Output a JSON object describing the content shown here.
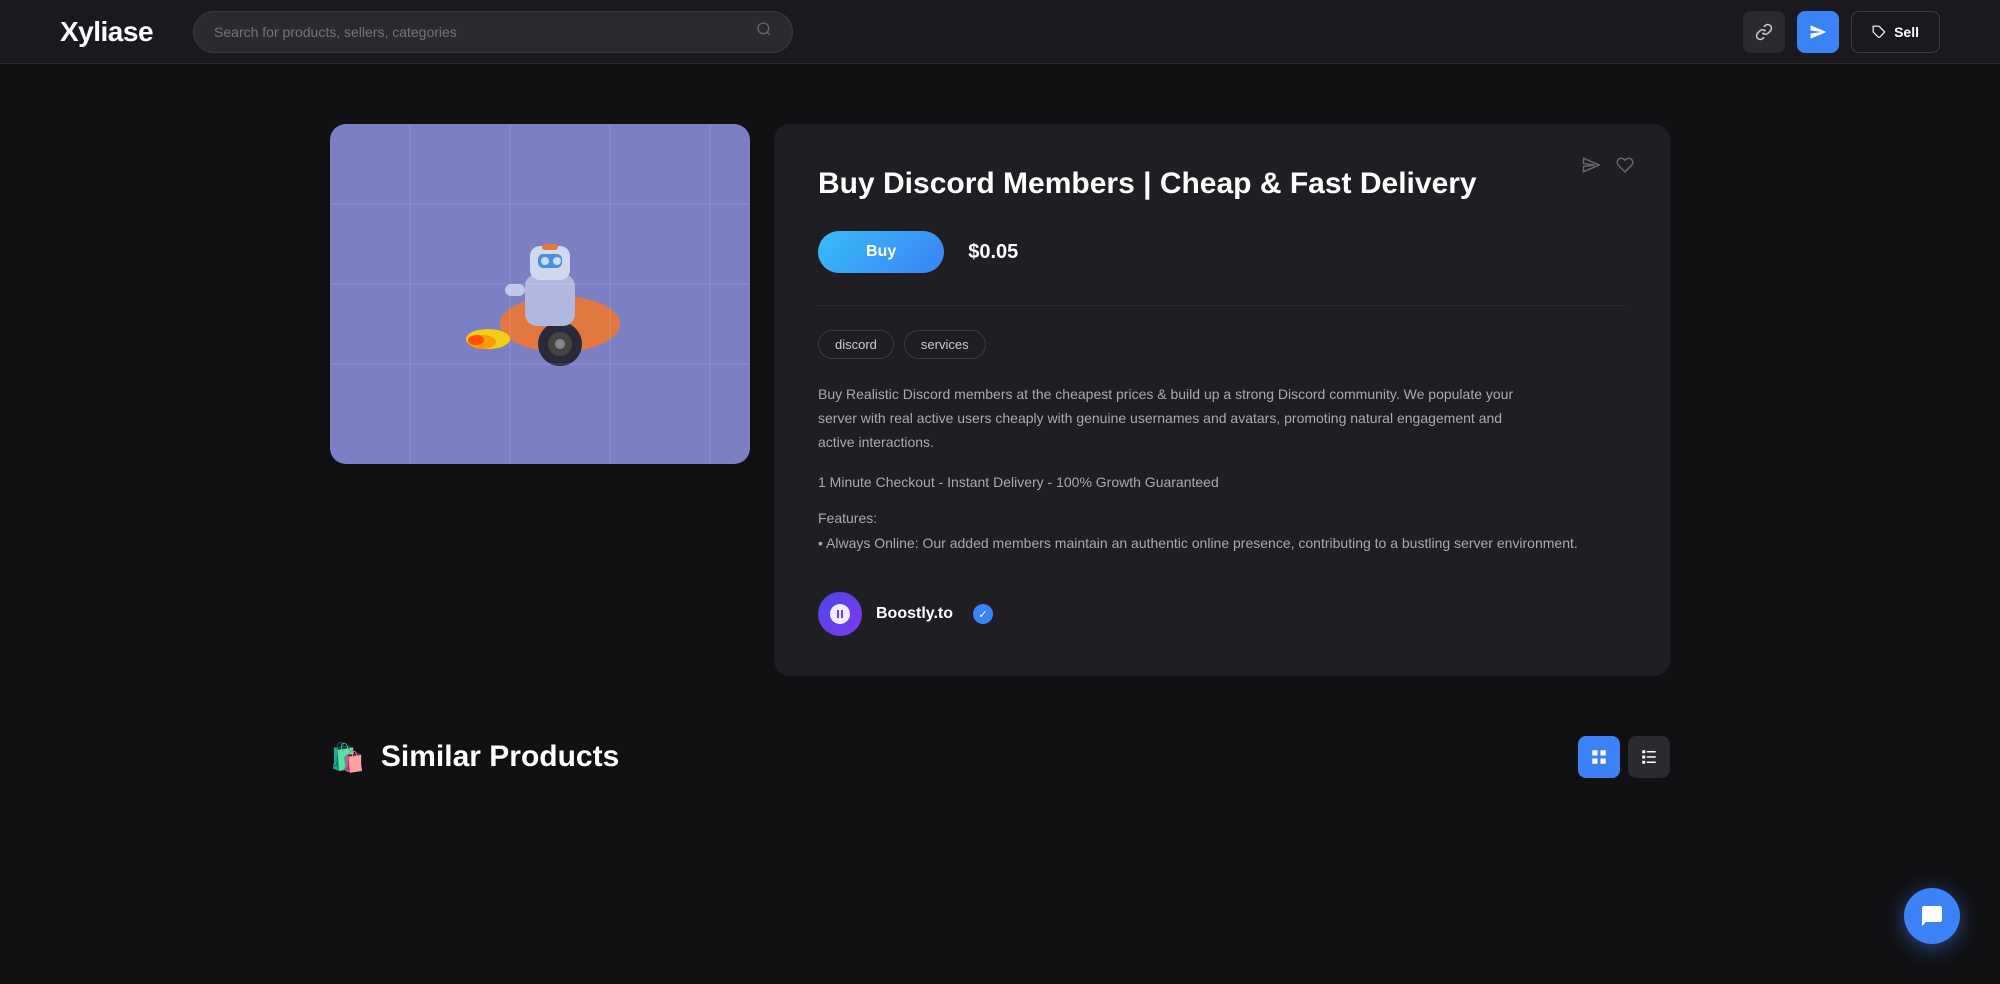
{
  "header": {
    "logo": "Xyliase",
    "search_placeholder": "Search for products, sellers, categories",
    "sell_label": "Sell"
  },
  "product": {
    "title": "Buy Discord Members | Cheap & Fast Delivery",
    "buy_label": "Buy",
    "price": "$0.05",
    "tags": [
      "discord",
      "services"
    ],
    "description": "Buy Realistic Discord members at the cheapest prices & build up a strong Discord community. We populate your server with real active users cheaply with genuine usernames and avatars, promoting natural engagement and active interactions.",
    "checkout_info": "1 Minute Checkout - Instant Delivery - 100% Growth Guaranteed",
    "features_header": "Features:",
    "feature_bullet": "• Always Online: Our added members maintain an authentic online presence, contributing to a bustling server environment.",
    "seller_name": "Boostly.to"
  },
  "bottom": {
    "similar_title": "Similar Products",
    "bag_icon": "🛍️"
  },
  "chat": {
    "icon": "💬"
  }
}
